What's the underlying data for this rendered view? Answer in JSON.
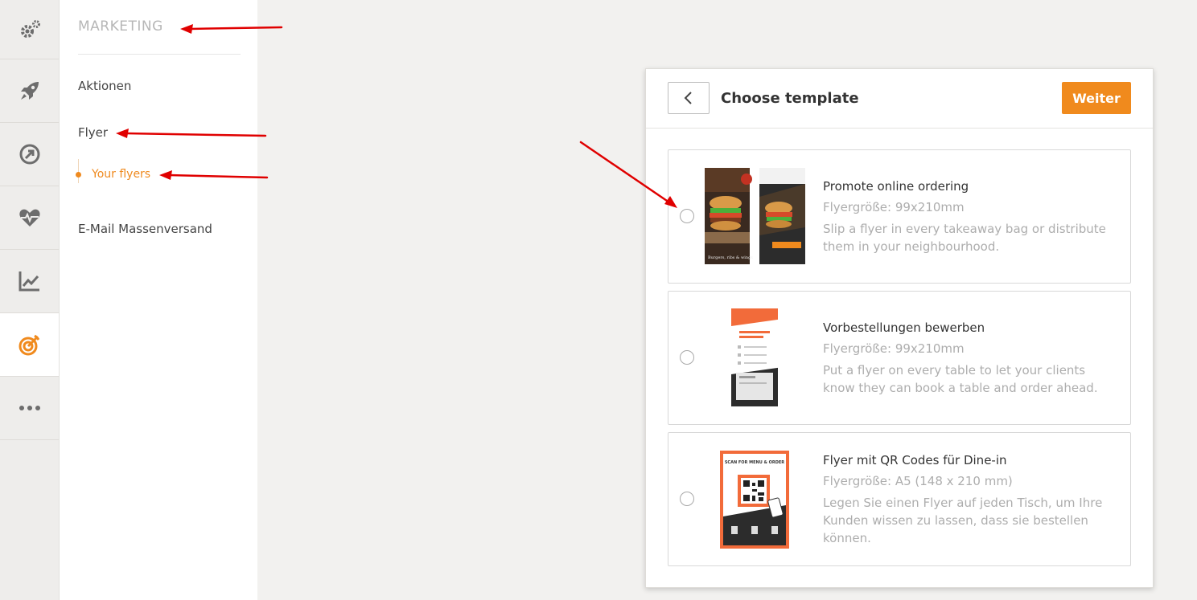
{
  "rail": {
    "items": [
      {
        "icon": "gears-icon"
      },
      {
        "icon": "rocket-icon"
      },
      {
        "icon": "target-arrow-circle-icon"
      },
      {
        "icon": "heart-pulse-icon"
      },
      {
        "icon": "line-chart-icon"
      },
      {
        "icon": "target-icon",
        "active": true
      },
      {
        "icon": "more-dots-icon"
      }
    ]
  },
  "subnav": {
    "title": "MARKETING",
    "items": [
      "Aktionen",
      "Flyer",
      "E-Mail Massenversand"
    ],
    "sub_item": "Your flyers"
  },
  "panel": {
    "title": "Choose template",
    "next_label": "Weiter",
    "templates": [
      {
        "title": "Promote online ordering",
        "size": "Flyergröße: 99x210mm",
        "description": "Slip a flyer in every takeaway bag or distribute them in your neighbourhood.",
        "thumb_caption": "Burgers, ribs & wings"
      },
      {
        "title": "Vorbestellungen bewerben",
        "size": "Flyergröße: 99x210mm",
        "description": "Put a flyer on every table to let your clients know they can book a table and order ahead."
      },
      {
        "title": "Flyer mit QR Codes für Dine-in",
        "size": "Flyergröße: A5 (148 x 210 mm)",
        "description": "Legen Sie einen Flyer auf jeden Tisch, um Ihre Kunden wissen zu lassen, dass sie bestellen können.",
        "thumb_caption": "SCAN FOR MENU & ORDER"
      }
    ]
  },
  "colors": {
    "accent": "#f08a1d",
    "rail_icon": "#6d6d6d",
    "annotation": "#e00000"
  }
}
